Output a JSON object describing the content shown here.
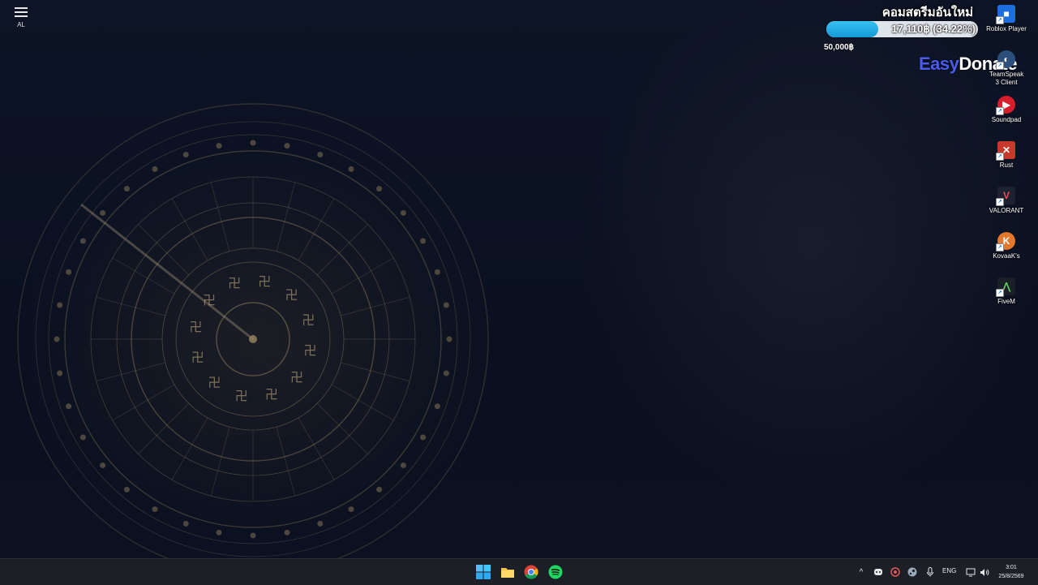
{
  "menu": {
    "label": "AL"
  },
  "donation": {
    "title": "คอมสตรีมอันใหม่",
    "amount_text": "17,110฿ (34.22%)",
    "progress_percent": 34.22,
    "goal_text": "50,000฿",
    "brand_part1": "Easy",
    "brand_part2": "Donate",
    "bar_color": "#1ea7e4"
  },
  "desktop_icons": [
    {
      "name": "Roblox Player",
      "icon": "roblox-icon",
      "color": "#1d6fe0"
    },
    {
      "name": "TeamSpeak 3 Client",
      "icon": "teamspeak-icon",
      "color": "#2b4f7a"
    },
    {
      "name": "Soundpad",
      "icon": "soundpad-icon",
      "color": "#d81e2a"
    },
    {
      "name": "Rust",
      "icon": "rust-icon",
      "color": "#c6392b"
    },
    {
      "name": "VALORANT",
      "icon": "valorant-icon",
      "color": "#1e2230"
    },
    {
      "name": "KovaaK's",
      "icon": "kovaaks-icon",
      "color": "#e2772e"
    },
    {
      "name": "FiveM",
      "icon": "fivem-icon",
      "color": "#1b1f28"
    }
  ],
  "taskbar": {
    "apps": [
      "windows-start-icon",
      "file-explorer-icon",
      "chrome-icon",
      "spotify-icon"
    ],
    "tray": {
      "icons": [
        "chevron-up-icon",
        "discord-icon",
        "tray-app-icon",
        "steam-icon",
        "microphone-icon"
      ],
      "language": "ENG",
      "system_icons": [
        "network-icon",
        "volume-icon"
      ]
    },
    "time": "3:01",
    "date": "25/8/2569"
  }
}
